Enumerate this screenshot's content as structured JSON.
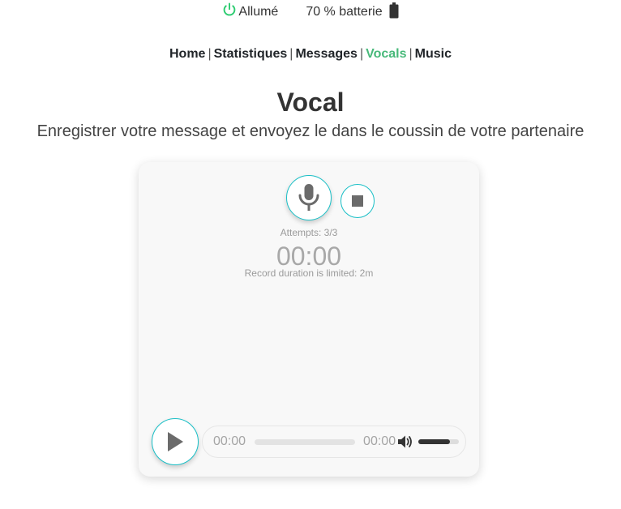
{
  "status": {
    "power_label": "Allumé",
    "battery_label": "70 % batterie",
    "colors": {
      "power": "#2ecc71",
      "battery": "#333333"
    },
    "icons": {
      "power": "power-icon",
      "battery": "battery-icon"
    }
  },
  "nav": {
    "items": [
      {
        "label": "Home",
        "active": false
      },
      {
        "label": "Statistiques",
        "active": false
      },
      {
        "label": "Messages",
        "active": false
      },
      {
        "label": "Vocals",
        "active": true
      },
      {
        "label": "Music",
        "active": false
      }
    ],
    "separator": "|",
    "active_color": "#48b97a"
  },
  "page": {
    "title": "Vocal",
    "subtitle": "Enregistrer votre message et envoyez le dans le coussin de votre partenaire"
  },
  "recorder": {
    "attempts": "Attempts: 3/3",
    "timer": "00:00",
    "limit_note": "Record duration is limited: 2m",
    "accent_color": "#19bfc6",
    "icons": {
      "record": "microphone-icon",
      "stop": "stop-icon",
      "play": "play-icon"
    }
  },
  "player": {
    "current_time": "00:00",
    "total_time": "00:00",
    "progress": 0,
    "volume": 0.78,
    "icons": {
      "volume": "volume-icon"
    }
  }
}
